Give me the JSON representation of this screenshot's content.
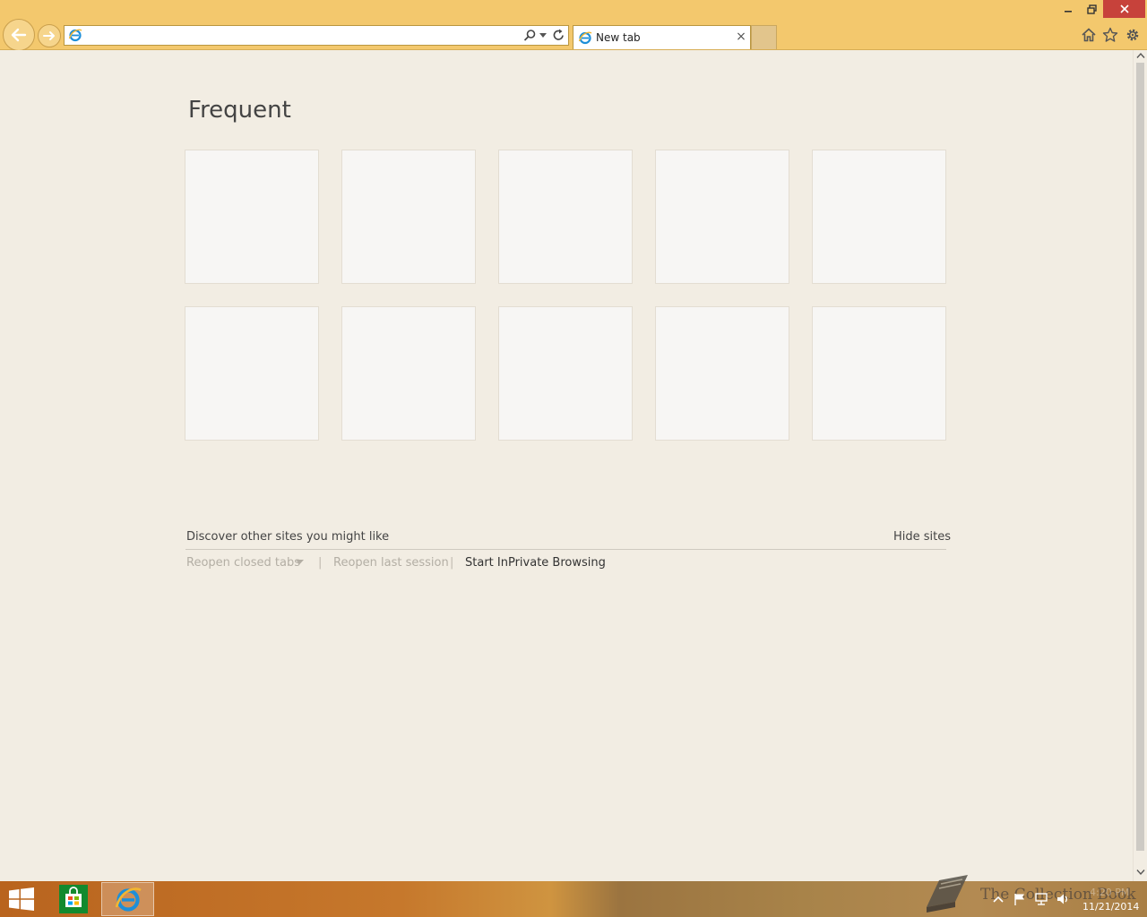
{
  "window": {
    "minimize_label": "🗕",
    "restore_label": "🗗",
    "close_label": "✕"
  },
  "addressbar": {
    "value": "",
    "placeholder": ""
  },
  "tabs": [
    {
      "label": "New tab",
      "close_label": "×"
    }
  ],
  "content": {
    "section_title": "Frequent",
    "tile_count": 10,
    "discover_label": "Discover other sites you might like",
    "hide_sites_label": "Hide sites",
    "reopen_closed_tabs_label": "Reopen closed tabs",
    "separator": "|",
    "reopen_last_session_label": "Reopen last session",
    "start_inprivate_label": "Start InPrivate Browsing"
  },
  "taskbar": {
    "watermark_text": "The Collection Book",
    "clock_time": "4:20 PM",
    "clock_date": "11/21/2014"
  },
  "colors": {
    "titlebar": "#f3c86d",
    "page_background": "#f2ede3",
    "tile_background": "#f7f6f4",
    "close_button": "#c7423b",
    "ie_blue": "#1e8fd8",
    "store_green": "#128a2e"
  },
  "icons": {
    "back": "arrow-left-icon",
    "forward": "arrow-right-icon",
    "address_site": "ie-icon",
    "search": "search-icon",
    "dropdown": "chevron-down-icon",
    "refresh": "refresh-icon",
    "home": "home-icon",
    "favorites": "star-icon",
    "tools": "gear-icon",
    "start": "windows-logo-icon",
    "store": "store-icon",
    "taskbar_ie": "ie-icon"
  }
}
